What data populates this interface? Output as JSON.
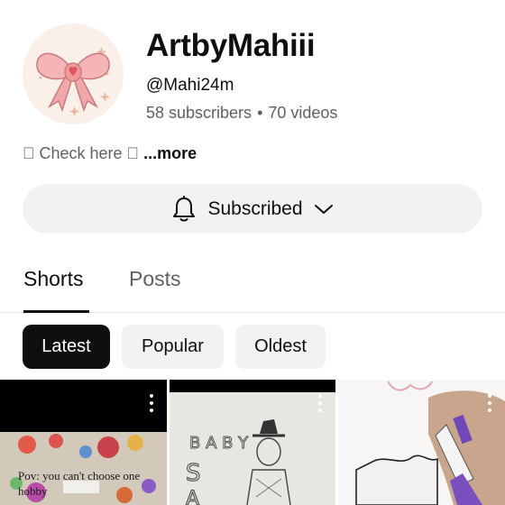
{
  "channel": {
    "name": "ArtbyMahiii",
    "handle": "@Mahi24m",
    "subscribers": "58 subscribers",
    "separator": "•",
    "videos": "70 videos"
  },
  "description": {
    "text": "\u0000 Check here \u0000 ",
    "more": "...more"
  },
  "subscribe_button": {
    "label": "Subscribed",
    "icon": "bell-icon",
    "dropdown_icon": "chevron-down-icon"
  },
  "tabs": [
    {
      "label": "Shorts",
      "selected": true
    },
    {
      "label": "Posts",
      "selected": false
    }
  ],
  "chips": [
    {
      "label": "Latest",
      "selected": true
    },
    {
      "label": "Popular",
      "selected": false
    },
    {
      "label": "Oldest",
      "selected": false
    }
  ],
  "shorts": [
    {
      "overlay_text": "Pov: you can't choose one hobby",
      "menu_icon": "more-vert-icon"
    },
    {
      "overlay_text": "",
      "menu_icon": "more-vert-icon"
    },
    {
      "overlay_text": "",
      "menu_icon": "more-vert-icon"
    }
  ],
  "colors": {
    "text_primary": "#0f0f0f",
    "text_secondary": "#606060",
    "chip_bg": "#f2f2f2",
    "chip_selected_bg": "#0f0f0f",
    "avatar_bg": "#fbefe9",
    "bow_pink": "#f2a7a9"
  }
}
